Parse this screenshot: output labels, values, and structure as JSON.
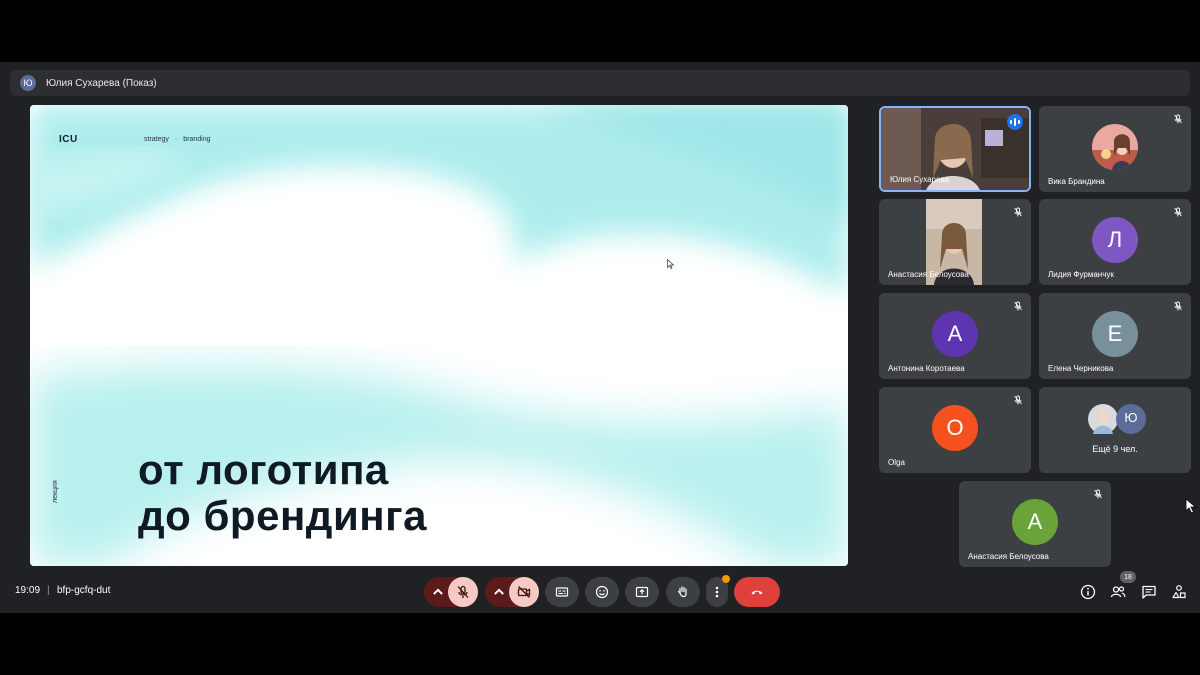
{
  "presenter": {
    "avatar_letter": "Ю",
    "label": "Юлия Сухарева (Показ)"
  },
  "slide": {
    "brand": "ICU",
    "tags": [
      "strategy",
      "branding"
    ],
    "tag_separator": "·",
    "title_line1": "от логотипа",
    "title_line2": "до брендинга",
    "vertical_label": "лекция",
    "colors": {
      "accent": "#a8ecec",
      "title": "#0f1a24"
    }
  },
  "participants": [
    {
      "name": "Юлия Сухарева",
      "type": "video",
      "speaking": true
    },
    {
      "name": "Вика Брандина",
      "type": "photo",
      "muted": true
    },
    {
      "name": "Анастасия Белоусова",
      "type": "video",
      "muted": true
    },
    {
      "name": "Лидия Фурманчук",
      "type": "letter",
      "letter": "Л",
      "color": "#7e57c2",
      "muted": true
    },
    {
      "name": "Антонина Коротаева",
      "type": "letter",
      "letter": "А",
      "color": "#5e35b1",
      "muted": true
    },
    {
      "name": "Елена Черникова",
      "type": "letter",
      "letter": "Е",
      "color": "#78909c",
      "muted": true
    },
    {
      "name": "Olga",
      "type": "letter",
      "letter": "O",
      "color": "#f4511e",
      "muted": true
    },
    {
      "name": "Анастасия Белоусова",
      "type": "letter",
      "letter": "А",
      "color": "#6aa33a",
      "muted": true
    }
  ],
  "more_tile": {
    "label": "Ещё 9 чел.",
    "avatar_letter": "Ю"
  },
  "bottom_bar": {
    "time": "19:09",
    "separator": "|",
    "meeting_code": "bfp-gcfq-dut",
    "participants_count": "18"
  },
  "icons": {
    "mic": "mic-off-icon",
    "camera": "camera-off-icon",
    "captions": "captions-icon",
    "emoji": "emoji-icon",
    "present": "present-screen-icon",
    "hand": "raise-hand-icon",
    "more": "more-options-icon",
    "end_call": "end-call-icon",
    "info": "info-icon",
    "people": "people-icon",
    "chat": "chat-icon",
    "activities": "activities-icon"
  }
}
